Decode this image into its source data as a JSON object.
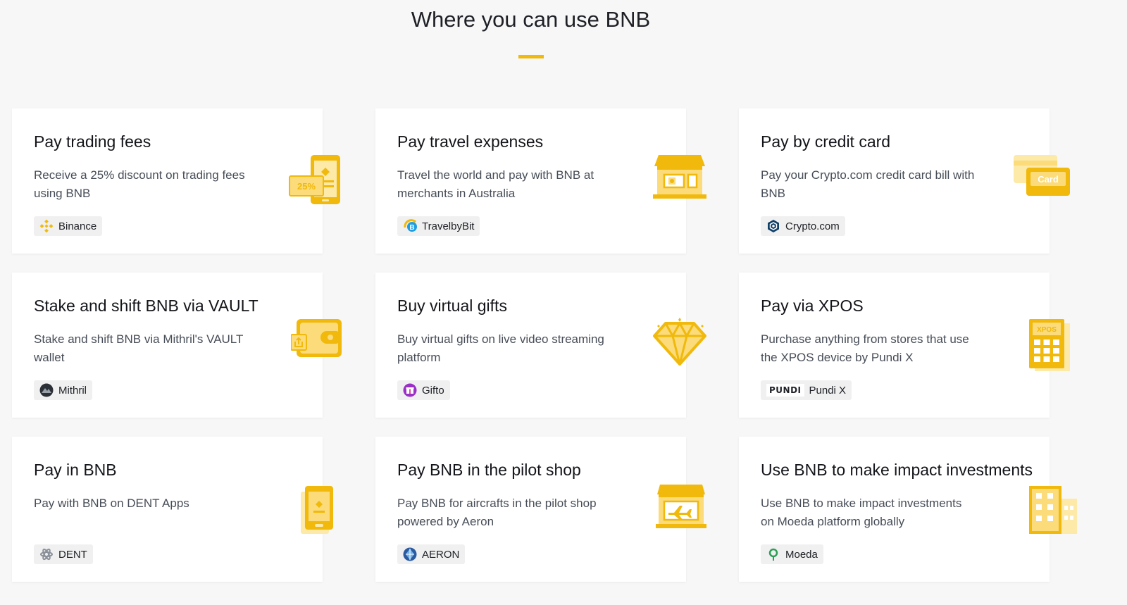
{
  "page": {
    "title": "Where you can use BNB",
    "accent_color": "#f0b90b"
  },
  "cards": [
    {
      "title": "Pay trading fees",
      "description": "Receive a 25% discount on trading fees using BNB",
      "partner": "Binance",
      "partner_icon": "binance-logo-icon",
      "illustration": "phone-discount-icon",
      "illustration_text": "25%"
    },
    {
      "title": "Pay travel expenses",
      "description": "Travel the world and pay with BNB at merchants in Australia",
      "partner": "TravelbyBit",
      "partner_icon": "travelbybit-logo-icon",
      "illustration": "shop-storefront-icon"
    },
    {
      "title": "Pay by credit card",
      "description": "Pay your Crypto.com credit card bill with BNB",
      "partner": "Crypto.com",
      "partner_icon": "crypto-com-logo-icon",
      "illustration": "credit-card-icon",
      "illustration_text": "Card"
    },
    {
      "title": "Stake and shift BNB via VAULT",
      "description": "Stake and shift BNB via Mithril's VAULT wallet",
      "partner": "Mithril",
      "partner_icon": "mithril-logo-icon",
      "illustration": "wallet-icon"
    },
    {
      "title": "Buy virtual gifts",
      "description": "Buy virtual gifts on live video streaming platform",
      "partner": "Gifto",
      "partner_icon": "gifto-logo-icon",
      "illustration": "diamond-icon"
    },
    {
      "title": "Pay via XPOS",
      "description": "Purchase anything from stores that use the XPOS device by Pundi X",
      "partner": "Pundi X",
      "partner_logo_text": "PUNDI",
      "partner_icon": "pundi-x-logo-icon",
      "illustration": "pos-terminal-icon",
      "illustration_text": "XPOS"
    },
    {
      "title": "Pay in BNB",
      "description": "Pay with BNB on DENT Apps",
      "partner": "DENT",
      "partner_icon": "dent-logo-icon",
      "illustration": "mobile-phone-icon"
    },
    {
      "title": "Pay BNB in the pilot shop",
      "description": "Pay BNB for aircrafts in the pilot shop powered by Aeron",
      "partner": "AERON",
      "partner_icon": "aeron-logo-icon",
      "illustration": "airplane-shop-icon"
    },
    {
      "title": "Use BNB to make impact investments",
      "description": "Use BNB to make impact investments on Moeda platform globally",
      "partner": "Moeda",
      "partner_icon": "moeda-logo-icon",
      "illustration": "building-icon"
    }
  ]
}
